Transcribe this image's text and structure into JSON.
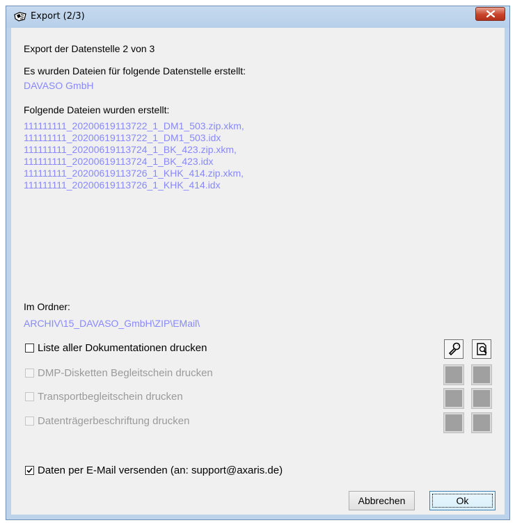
{
  "window": {
    "title": "Export (2/3)"
  },
  "content": {
    "heading": "Export der Datenstelle 2 von 3",
    "created_for_label": "Es wurden Dateien für folgende Datenstelle erstellt:",
    "datastelle": "DAVASO GmbH",
    "files_label": "Folgende Dateien wurden erstellt:",
    "files": [
      "111111111_20200619113722_1_DM1_503.zip.xkm,",
      "111111111_20200619113722_1_DM1_503.idx",
      "111111111_20200619113724_1_BK_423.zip.xkm,",
      "111111111_20200619113724_1_BK_423.idx",
      "111111111_20200619113726_1_KHK_414.zip.xkm,",
      "111111111_20200619113726_1_KHK_414.idx"
    ],
    "folder_label": "Im Ordner:",
    "folder_path": "ARCHIV\\15_DAVASO_GmbH\\ZIP\\EMail\\"
  },
  "options": [
    {
      "label": "Liste aller Dokumentationen drucken",
      "checked": false,
      "enabled": true
    },
    {
      "label": "DMP-Disketten Begleitschein drucken",
      "checked": false,
      "enabled": false
    },
    {
      "label": "Transportbegleitschein drucken",
      "checked": false,
      "enabled": false
    },
    {
      "label": "Datenträgerbeschriftung drucken",
      "checked": false,
      "enabled": false
    }
  ],
  "email": {
    "label": "Daten per E-Mail versenden (an: support@axaris.de)",
    "checked": true
  },
  "icons": {
    "settings": "wrench-icon",
    "preview": "print-preview-icon"
  },
  "buttons": {
    "cancel": "Abbrechen",
    "ok": "Ok"
  },
  "colors": {
    "link_text": "#8888ff",
    "frame": "#bcd3ea",
    "close_button": "#c8432b"
  }
}
